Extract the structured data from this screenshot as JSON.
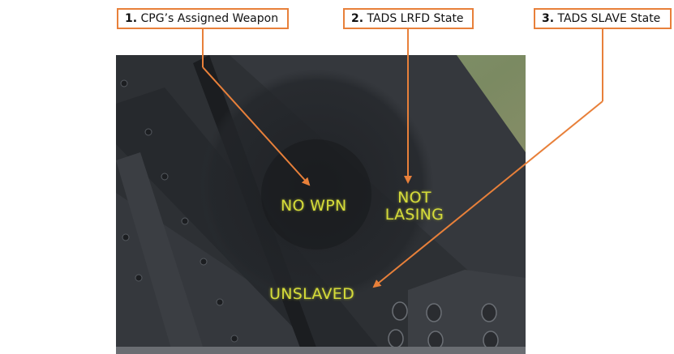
{
  "callouts": [
    {
      "number": "1.",
      "label": "CPG’s Assigned Weapon"
    },
    {
      "number": "2.",
      "label": "TADS LRFD State"
    },
    {
      "number": "3.",
      "label": "TADS SLAVE State"
    }
  ],
  "symbology": {
    "weapon_status": "NO WPN",
    "lrfd_line1": "NOT",
    "lrfd_line2": "LASING",
    "slave_status": "UNSLAVED"
  },
  "colors": {
    "callout_accent": "#e8803a",
    "symbology": "#d6dc3a"
  }
}
